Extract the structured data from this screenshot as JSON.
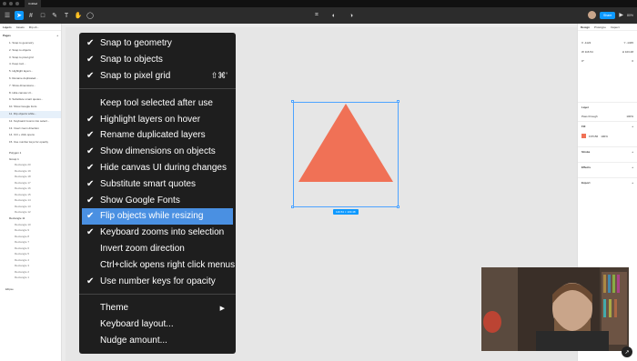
{
  "app": {
    "file_tab": "Untitled",
    "zoom": "80%",
    "share_label": "Share"
  },
  "left_panel": {
    "tabs": [
      "Layers",
      "Assets",
      "Flip ob..."
    ],
    "pages_heading": "Pages",
    "pages": [
      "1. Snap to geometry",
      "2. Snap to objects",
      "3. Snap to pixel grid",
      "4. Keep tool...",
      "5. Highlight layers...",
      "6. Rename duplicated...",
      "7. Show dimensions...",
      "8. Hide canvas UI...",
      "9. Substitute smart quotes...",
      "10. Show Google fonts",
      "11. Flip objects while...",
      "12. Keyboard zooms into select...",
      "13. Invert zoom direction",
      "14. Ctrl + click opens",
      "15. Use number keys for opacity"
    ],
    "layers": [
      {
        "name": "Polygon 1",
        "kind": "frame"
      },
      {
        "name": "Group 1",
        "kind": "frame"
      },
      {
        "name": "Rectangle 20",
        "kind": "sub"
      },
      {
        "name": "Rectangle 19",
        "kind": "sub"
      },
      {
        "name": "Rectangle 18",
        "kind": "sub"
      },
      {
        "name": "Rectangle 17",
        "kind": "sub"
      },
      {
        "name": "Rectangle 16",
        "kind": "sub"
      },
      {
        "name": "Rectangle 15",
        "kind": "sub"
      },
      {
        "name": "Rectangle 14",
        "kind": "sub"
      },
      {
        "name": "Rectangle 13",
        "kind": "sub"
      },
      {
        "name": "Rectangle 12",
        "kind": "sub"
      },
      {
        "name": "Rectangle 11",
        "kind": "frame"
      },
      {
        "name": "Rectangle 10",
        "kind": "sub"
      },
      {
        "name": "Rectangle 9",
        "kind": "sub"
      },
      {
        "name": "Rectangle 8",
        "kind": "sub"
      },
      {
        "name": "Rectangle 7",
        "kind": "sub"
      },
      {
        "name": "Rectangle 6",
        "kind": "sub"
      },
      {
        "name": "Rectangle 5",
        "kind": "sub"
      },
      {
        "name": "Rectangle 4",
        "kind": "sub"
      },
      {
        "name": "Rectangle 3",
        "kind": "sub"
      },
      {
        "name": "Rectangle 2",
        "kind": "sub"
      },
      {
        "name": "Rectangle 1",
        "kind": "sub"
      }
    ],
    "footer": "Ellipse"
  },
  "canvas": {
    "dimension_label": "116.54 × 103.48",
    "triangle_color": "#f07156",
    "selection_color": "#4da3ff"
  },
  "right_panel": {
    "tabs": [
      "Design",
      "Prototype",
      "Inspect"
    ],
    "props": [
      [
        "X",
        "-1122",
        "Y",
        "-1345"
      ],
      [
        "W",
        "116.54",
        "H",
        "103.48"
      ],
      [
        "",
        "0°",
        "",
        "0"
      ]
    ],
    "layer_heading": "Layer",
    "layer_blend": "Pass through",
    "layer_opacity": "100%",
    "fill_heading": "Fill",
    "fill_hex": "F07156",
    "fill_opacity": "100%",
    "sections": [
      "Stroke",
      "Effects",
      "Export"
    ]
  },
  "menu": {
    "items": [
      {
        "label": "Snap to geometry",
        "checked": true
      },
      {
        "label": "Snap to objects",
        "checked": true
      },
      {
        "label": "Snap to pixel grid",
        "checked": true,
        "shortcut": "⇧⌘'"
      },
      {
        "separator": true
      },
      {
        "label": "Keep tool selected after use",
        "checked": false
      },
      {
        "label": "Highlight layers on hover",
        "checked": true
      },
      {
        "label": "Rename duplicated layers",
        "checked": true
      },
      {
        "label": "Show dimensions on objects",
        "checked": true
      },
      {
        "label": "Hide canvas UI during changes",
        "checked": true
      },
      {
        "label": "Substitute smart quotes",
        "checked": true
      },
      {
        "label": "Show Google Fonts",
        "checked": true
      },
      {
        "label": "Flip objects while resizing",
        "checked": true,
        "highlighted": true
      },
      {
        "label": "Keyboard zooms into selection",
        "checked": true
      },
      {
        "label": "Invert zoom direction",
        "checked": false
      },
      {
        "label": "Ctrl+click opens right click menus",
        "checked": false
      },
      {
        "label": "Use number keys for opacity",
        "checked": true
      },
      {
        "separator": true
      },
      {
        "label": "Theme",
        "checked": false,
        "submenu": true
      },
      {
        "label": "Keyboard layout...",
        "checked": false
      },
      {
        "label": "Nudge amount...",
        "checked": false
      }
    ],
    "check_glyph": "✔",
    "submenu_glyph": "▶"
  }
}
